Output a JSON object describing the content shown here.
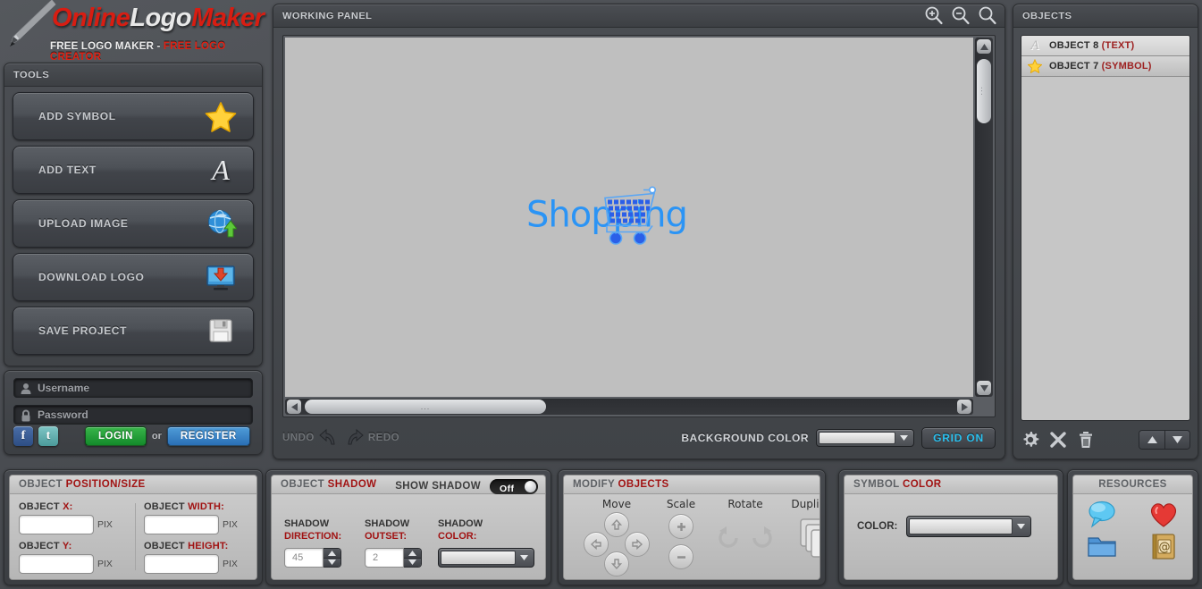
{
  "brand": {
    "name_part1": "Online",
    "name_part2": "Logo",
    "name_part3": "Maker",
    "tagline_part1": "FREE LOGO MAKER - ",
    "tagline_part2": "FREE LOGO CREATOR",
    "pen_icon": "fountain-pen-icon"
  },
  "tools": {
    "header": "TOOLS",
    "items": [
      {
        "label": "ADD SYMBOL",
        "icon": "star-icon"
      },
      {
        "label": "ADD TEXT",
        "icon": "letter-a-icon"
      },
      {
        "label": "UPLOAD IMAGE",
        "icon": "globe-upload-icon"
      },
      {
        "label": "DOWNLOAD LOGO",
        "icon": "monitor-download-icon"
      },
      {
        "label": "SAVE PROJECT",
        "icon": "floppy-disk-icon"
      }
    ]
  },
  "login": {
    "username_placeholder": "Username",
    "password_placeholder": "Password",
    "username_value": "",
    "password_value": "",
    "user_icon": "user-icon",
    "lock_icon": "lock-icon",
    "facebook_glyph": "f",
    "twitter_glyph": "t",
    "login_label": "LOGIN",
    "or_label": "or",
    "register_label": "REGISTER"
  },
  "working_panel": {
    "header": "WORKING PANEL",
    "zoom_in_icon": "zoom-in-icon",
    "zoom_out_icon": "zoom-out-icon",
    "zoom_reset_icon": "magnifier-icon",
    "canvas": {
      "background_color": "#bfbfbf",
      "logo_text": "Shopping",
      "logo_text_color": "#2b94f5",
      "symbol_name": "shopping-cart-symbol",
      "symbol_color": "#2b5fe8"
    },
    "undo_label": "UNDO",
    "redo_label": "REDO",
    "undo_icon": "undo-arrow-icon",
    "redo_icon": "redo-arrow-icon",
    "background_color_label": "BACKGROUND COLOR",
    "background_color_value": "#e9e9e9",
    "grid_label": "GRID ON",
    "grid_label_color": "#2cc2f0",
    "scroll_dots": "..."
  },
  "objects": {
    "header": "OBJECTS",
    "items": [
      {
        "label": "OBJECT 8",
        "type": "(TEXT)",
        "icon": "letter-a-icon"
      },
      {
        "label": "OBJECT 7",
        "type": "(SYMBOL)",
        "icon": "star-icon"
      }
    ],
    "type_color": "#9d2020",
    "tools": [
      {
        "name": "gear-icon"
      },
      {
        "name": "close-x-icon"
      },
      {
        "name": "trash-icon"
      }
    ],
    "move_up_icon": "arrow-up-icon",
    "move_down_icon": "arrow-down-icon"
  },
  "position_size": {
    "header_part1": "OBJECT ",
    "header_part2": "POSITION/SIZE",
    "fields": [
      {
        "label_part1": "OBJECT ",
        "label_part2": "X:",
        "value": "",
        "unit": "PIX"
      },
      {
        "label_part1": "OBJECT ",
        "label_part2": "Y:",
        "value": "",
        "unit": "PIX"
      },
      {
        "label_part1": "OBJECT ",
        "label_part2": "WIDTH:",
        "value": "",
        "unit": "PIX"
      },
      {
        "label_part1": "OBJECT ",
        "label_part2": "HEIGHT:",
        "value": "",
        "unit": "PIX"
      }
    ]
  },
  "shadow": {
    "header_part1": "OBJECT ",
    "header_part2": "SHADOW",
    "show_shadow_label": "SHOW SHADOW",
    "toggle_state": "Off",
    "direction_label_part1": "SHADOW",
    "direction_label_part2": "DIRECTION:",
    "direction_value": "45",
    "outset_label_part1": "SHADOW",
    "outset_label_part2": "OUTSET:",
    "outset_value": "2",
    "color_label_part1": "SHADOW",
    "color_label_part2": "COLOR:",
    "color_value": "#e9e9e9"
  },
  "modify": {
    "header_part1": "MODIFY ",
    "header_part2": "OBJECTS",
    "move_label": "Move",
    "scale_label": "Scale",
    "rotate_label": "Rotate",
    "duplicate_label": "Duplicate",
    "icons": {
      "move_up": "arrow-up-circle-icon",
      "move_down": "arrow-down-circle-icon",
      "move_left": "arrow-left-circle-icon",
      "move_right": "arrow-right-circle-icon",
      "scale_up": "plus-circle-icon",
      "scale_down": "minus-circle-icon",
      "rotate_ccw": "rotate-counterclockwise-icon",
      "rotate_cw": "rotate-clockwise-icon",
      "duplicate": "copy-layers-icon"
    }
  },
  "symbol_color": {
    "header_part1": "SYMBOL ",
    "header_part2": "COLOR",
    "color_label": "COLOR:",
    "color_value": "#e9e9e9"
  },
  "resources": {
    "header": "RESOURCES",
    "items": [
      {
        "name": "speech-bubble-icon",
        "color": "#4fc3f7"
      },
      {
        "name": "heart-icon",
        "color": "#e53935"
      },
      {
        "name": "folder-icon",
        "color": "#5b9bd5"
      },
      {
        "name": "address-book-icon",
        "color": "#c8a košik"
      }
    ]
  },
  "theme": {
    "accent_red": "#a11313",
    "brand_red": "#d81d12",
    "cyan": "#2cc2f0",
    "panel_dark": "#3f4246",
    "panel_light": "#c3c3c3"
  }
}
